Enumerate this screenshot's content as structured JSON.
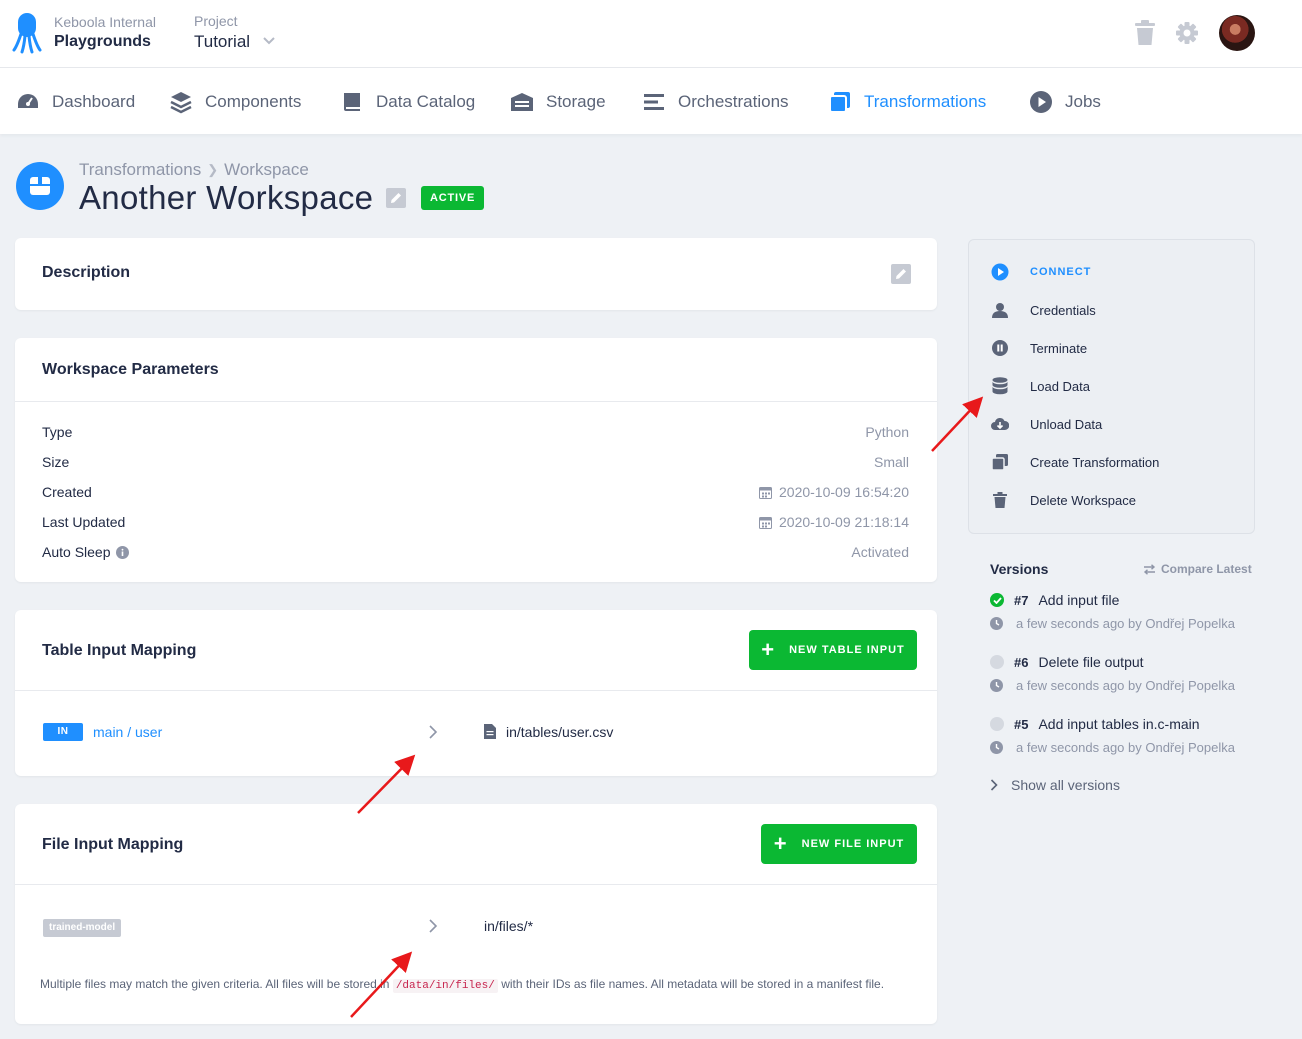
{
  "topbar": {
    "org_label": "Keboola Internal",
    "org_name": "Playgrounds",
    "project_label": "Project",
    "project_name": "Tutorial",
    "icons": [
      "trash-icon",
      "gear-icon",
      "avatar"
    ]
  },
  "nav": {
    "items": [
      {
        "label": "Dashboard",
        "icon": "dashboard-icon"
      },
      {
        "label": "Components",
        "icon": "layers-icon"
      },
      {
        "label": "Data Catalog",
        "icon": "book-icon"
      },
      {
        "label": "Storage",
        "icon": "warehouse-icon"
      },
      {
        "label": "Orchestrations",
        "icon": "bars-icon"
      },
      {
        "label": "Transformations",
        "icon": "transformations-icon",
        "active": true
      },
      {
        "label": "Jobs",
        "icon": "play-circle-icon"
      }
    ]
  },
  "page": {
    "breadcrumb": [
      "Transformations",
      "Workspace"
    ],
    "title": "Another Workspace",
    "status": "ACTIVE"
  },
  "description": {
    "title": "Description"
  },
  "params": {
    "title": "Workspace Parameters",
    "rows": [
      {
        "label": "Type",
        "value": "Python"
      },
      {
        "label": "Size",
        "value": "Small"
      },
      {
        "label": "Created",
        "value": "2020-10-09 16:54:20"
      },
      {
        "label": "Last Updated",
        "value": "2020-10-09 21:18:14"
      },
      {
        "label": "Auto Sleep",
        "value": "Activated"
      }
    ]
  },
  "table_input": {
    "title": "Table Input Mapping",
    "button": "NEW TABLE INPUT",
    "tag": "IN",
    "source": "main / user",
    "destination": "in/tables/user.csv"
  },
  "file_input": {
    "title": "File Input Mapping",
    "button": "NEW FILE INPUT",
    "tag": "trained-model",
    "destination": "in/files/*",
    "note_pre": "Multiple files may match the given criteria. All files will be stored in",
    "note_code": "/data/in/files/",
    "note_post": "with their IDs as file names. All metadata will be stored in a manifest file."
  },
  "actions": {
    "items": [
      "CONNECT",
      "Credentials",
      "Terminate",
      "Load Data",
      "Unload Data",
      "Create Transformation",
      "Delete Workspace"
    ]
  },
  "versions": {
    "title": "Versions",
    "compare": "Compare Latest",
    "list": [
      {
        "num": "#7",
        "name": "Add input file",
        "meta": "a few seconds ago by Ondřej Popelka",
        "current": true
      },
      {
        "num": "#6",
        "name": "Delete file output",
        "meta": "a few seconds ago by Ondřej Popelka",
        "current": false
      },
      {
        "num": "#5",
        "name": "Add input tables in.c-main",
        "meta": "a few seconds ago by Ondřej Popelka",
        "current": false
      }
    ],
    "show_all": "Show all versions"
  },
  "colors": {
    "accent": "#1f8fff",
    "success": "#0bb833",
    "annotation_arrow": "#e8191b"
  }
}
